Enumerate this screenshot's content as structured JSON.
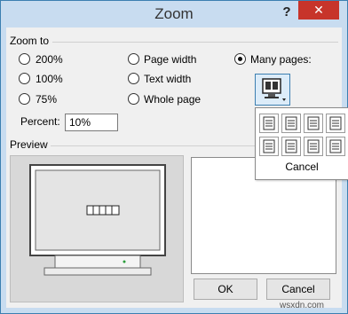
{
  "window": {
    "title": "Zoom",
    "help": "?",
    "close": "✕"
  },
  "zoom_to": {
    "legend": "Zoom to",
    "options": {
      "p200": "200%",
      "p100": "100%",
      "p75": "75%",
      "page_width": "Page width",
      "text_width": "Text width",
      "whole_page": "Whole page",
      "many_pages": "Many pages:"
    },
    "selected": "many_pages"
  },
  "percent": {
    "label": "Percent:",
    "value": "10%"
  },
  "preview": {
    "legend": "Preview"
  },
  "popup": {
    "cancel": "Cancel"
  },
  "buttons": {
    "ok": "OK",
    "cancel": "Cancel"
  },
  "watermark": "wsxdn.com"
}
